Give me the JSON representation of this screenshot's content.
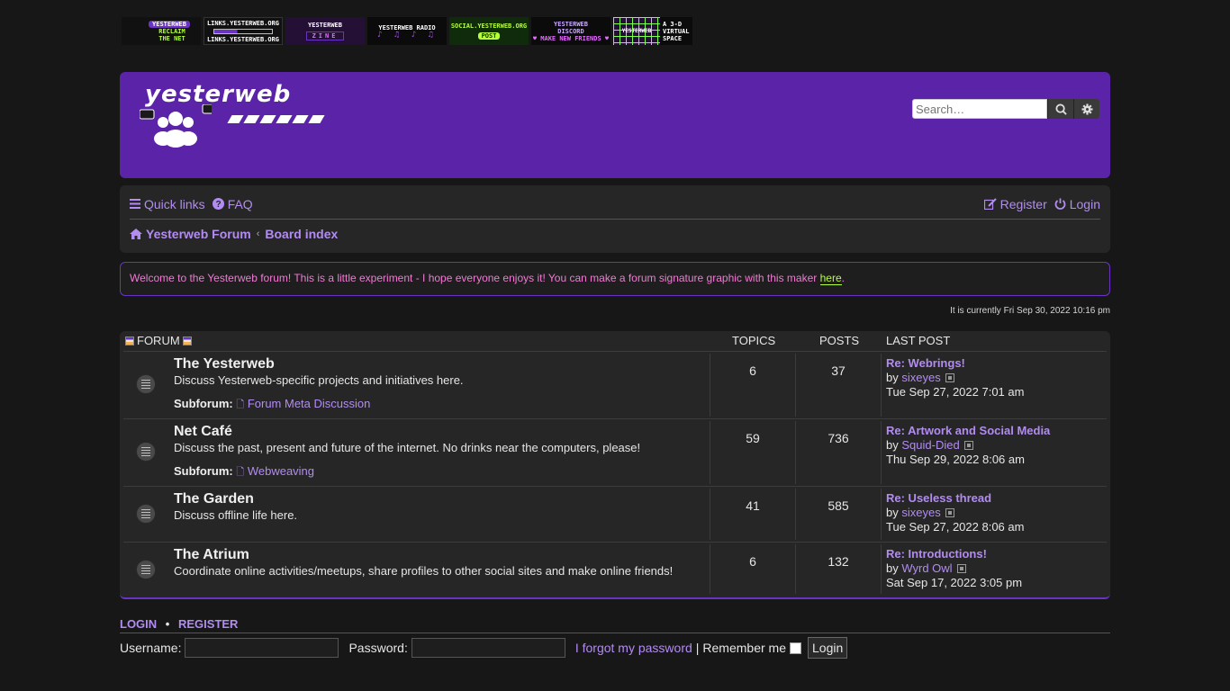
{
  "banners": [
    {
      "name": "banner-yesterweb-reclaim",
      "line1": "YESTERWEB",
      "line2": "RECLAIM",
      "line3": "THE NET"
    },
    {
      "name": "banner-links",
      "line1": "LINKS.YESTERWEB.ORG",
      "line2": "LINKS.YESTERWEB.ORG"
    },
    {
      "name": "banner-zine",
      "line1": "YESTERWEB",
      "line2": "ZINE"
    },
    {
      "name": "banner-radio",
      "line1": "YESTERWEB RADIO",
      "line2": "♪ ♫ ♪ ♫"
    },
    {
      "name": "banner-social",
      "line1": "SOCIAL.YESTERWEB.ORG",
      "line2": "POST"
    },
    {
      "name": "banner-discord",
      "line1": "YESTERWEB",
      "line2": "DISCORD",
      "line3": "♥ MAKE NEW FRIENDS ♥"
    },
    {
      "name": "banner-cafe",
      "line1": "YESTERWEB",
      "line2": "CAFE",
      "line3": "A 3-D VIRTUAL SPACE"
    }
  ],
  "header": {
    "logo_text": "yesterweb",
    "search_placeholder": "Search…",
    "colors": {
      "brand": "#5b24a8",
      "accent": "#b28cf1"
    }
  },
  "nav": {
    "quick_links": "Quick links",
    "faq": "FAQ",
    "register": "Register",
    "login": "Login",
    "breadcrumb": [
      "Yesterweb Forum",
      "Board index"
    ]
  },
  "announcement": {
    "text": "Welcome to the Yesterweb forum! This is a little experiment - I hope everyone enjoys it! You can make a forum signature graphic with this maker",
    "link": "here",
    "after": "."
  },
  "time": "It is currently Fri Sep 30, 2022 10:16 pm",
  "forum_table": {
    "headers": {
      "forum": "FORUM",
      "topics": "TOPICS",
      "posts": "POSTS",
      "last_post": "LAST POST"
    },
    "rows": [
      {
        "title": "The Yesterweb",
        "desc": "Discuss Yesterweb-specific projects and initiatives here.",
        "subforum_label": "Subforum:",
        "subforum": "Forum Meta Discussion",
        "topics": "6",
        "posts": "37",
        "last_title": "Re: Webrings!",
        "by": "by",
        "user": "sixeyes",
        "date": "Tue Sep 27, 2022 7:01 am"
      },
      {
        "title": "Net Café",
        "desc": "Discuss the past, present and future of the internet. No drinks near the computers, please!",
        "subforum_label": "Subforum:",
        "subforum": "Webweaving",
        "topics": "59",
        "posts": "736",
        "last_title": "Re: Artwork and Social Media",
        "by": "by",
        "user": "Squid-Died",
        "date": "Thu Sep 29, 2022 8:06 am"
      },
      {
        "title": "The Garden",
        "desc": "Discuss offline life here.",
        "topics": "41",
        "posts": "585",
        "last_title": "Re: Useless thread",
        "by": "by",
        "user": "sixeyes",
        "date": "Tue Sep 27, 2022 8:06 am"
      },
      {
        "title": "The Atrium",
        "desc": "Coordinate online activities/meetups, share profiles to other social sites and make online friends!",
        "topics": "6",
        "posts": "132",
        "last_title": "Re: Introductions!",
        "by": "by",
        "user": "Wyrd Owl",
        "date": "Sat Sep 17, 2022 3:05 pm"
      }
    ]
  },
  "login": {
    "login_link": "LOGIN",
    "separator": "•",
    "register_link": "REGISTER",
    "username_label": "Username:",
    "password_label": "Password:",
    "forgot": "I forgot my password",
    "pipe": "|",
    "remember": "Remember me",
    "button": "Login"
  }
}
